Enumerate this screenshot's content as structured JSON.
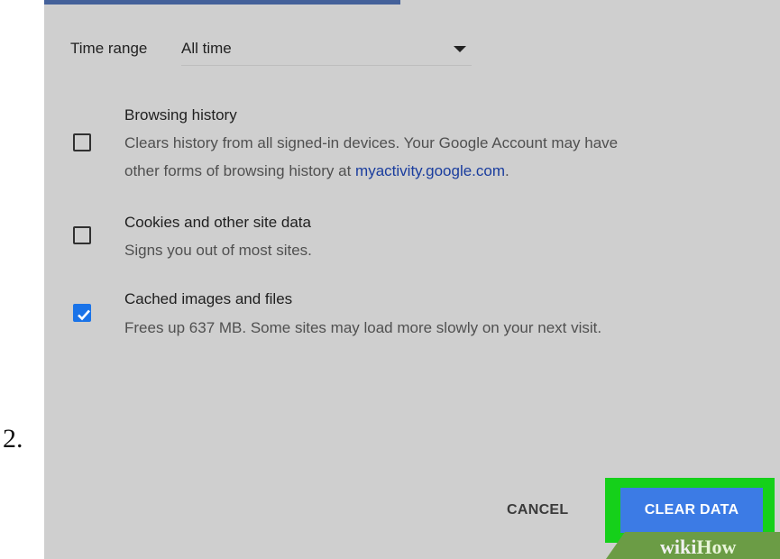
{
  "step": "2.",
  "time_range": {
    "label": "Time range",
    "value": "All time"
  },
  "options": [
    {
      "title": "Browsing history",
      "desc_line1": "Clears history from all signed-in devices. Your Google Account may have",
      "desc_line2_prefix": "other forms of browsing history at ",
      "desc_link": "myactivity.google.com",
      "desc_line2_suffix": ".",
      "checked": false
    },
    {
      "title": "Cookies and other site data",
      "desc_line1": "Signs you out of most sites.",
      "checked": false
    },
    {
      "title": "Cached images and files",
      "desc_line1": "Frees up 637 MB. Some sites may load more slowly on your next visit.",
      "checked": true
    }
  ],
  "buttons": {
    "cancel": "CANCEL",
    "clear": "CLEAR DATA"
  },
  "watermark": {
    "wiki": "wiki",
    "how": "How"
  },
  "colors": {
    "panel": "#cfcfcf",
    "accent_blue": "#3c7be5",
    "highlight_green": "#15d01a",
    "link_blue": "#1a3d9e"
  }
}
